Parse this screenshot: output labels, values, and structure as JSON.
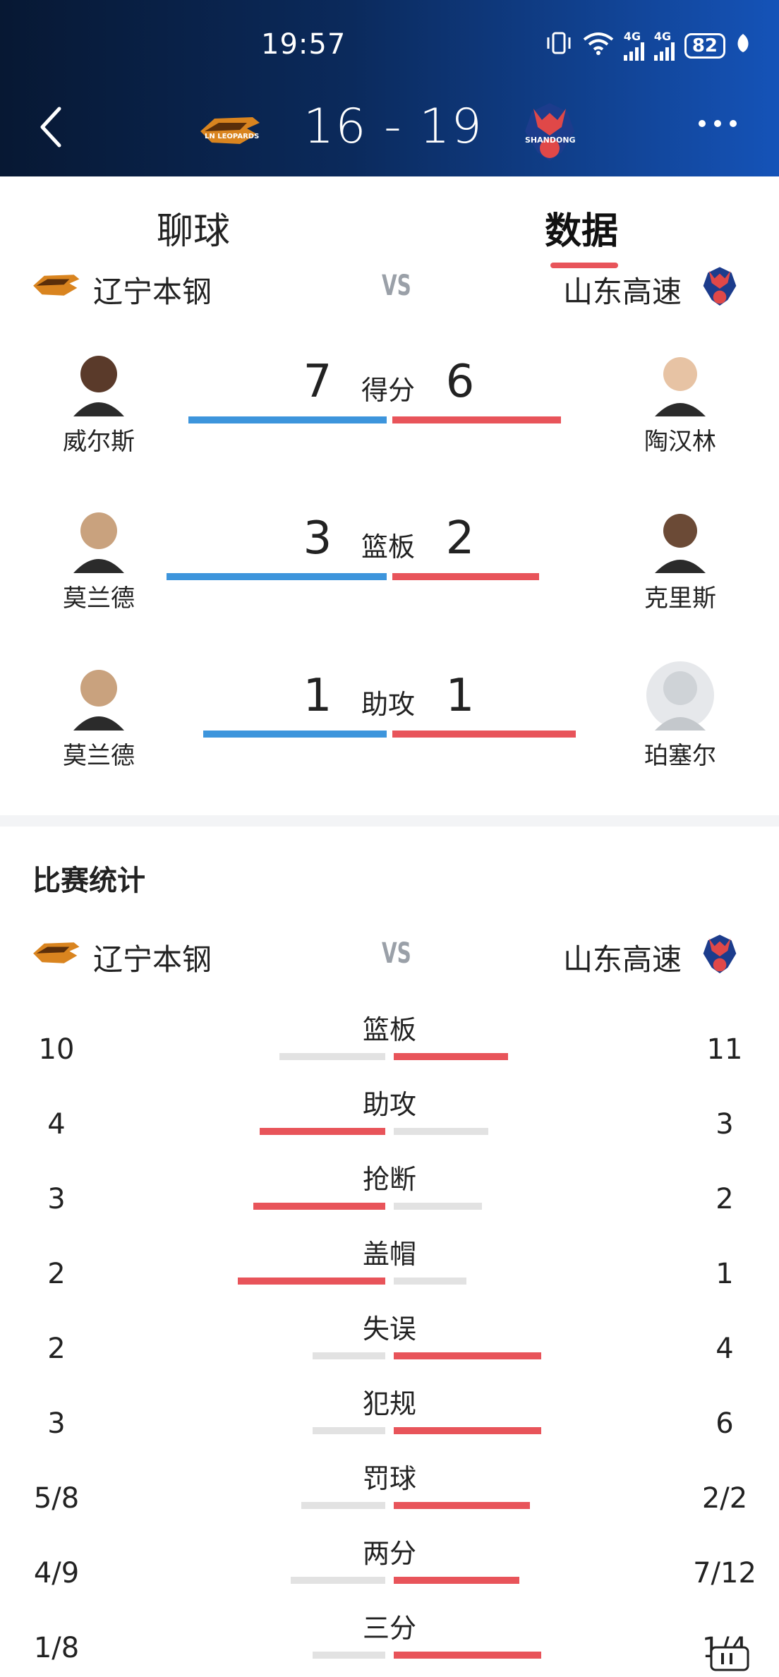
{
  "status_bar": {
    "time": "19:57",
    "battery": "82",
    "net1": "4G",
    "net2": "4G"
  },
  "header": {
    "score": "16 - 19",
    "home_logo_text": "LN LEOPARDS",
    "away_logo_text": "SHANDONG"
  },
  "tabs": [
    {
      "label": "聊球"
    },
    {
      "label": "数据"
    }
  ],
  "teams": {
    "home": "辽宁本钢",
    "away": "山东高速",
    "vs": "VS"
  },
  "leaders": [
    {
      "category": "得分",
      "home_player": "威尔斯",
      "home_value": "7",
      "away_player": "陶汉林",
      "away_value": "6",
      "home_share": 0.54
    },
    {
      "category": "篮板",
      "home_player": "莫兰德",
      "home_value": "3",
      "away_player": "克里斯",
      "away_value": "2",
      "home_share": 0.6
    },
    {
      "category": "助攻",
      "home_player": "莫兰德",
      "home_value": "1",
      "away_player": "珀塞尔",
      "away_value": "1",
      "home_share": 0.5
    }
  ],
  "stats_section": {
    "title": "比赛统计"
  },
  "stats": [
    {
      "category": "篮板",
      "home": "10",
      "away": "11",
      "home_frac": 0.48,
      "away_frac": 0.52,
      "leader": "away"
    },
    {
      "category": "助攻",
      "home": "4",
      "away": "3",
      "home_frac": 0.57,
      "away_frac": 0.43,
      "leader": "home"
    },
    {
      "category": "抢断",
      "home": "3",
      "away": "2",
      "home_frac": 0.6,
      "away_frac": 0.4,
      "leader": "home"
    },
    {
      "category": "盖帽",
      "home": "2",
      "away": "1",
      "home_frac": 0.67,
      "away_frac": 0.33,
      "leader": "home"
    },
    {
      "category": "失误",
      "home": "2",
      "away": "4",
      "home_frac": 0.33,
      "away_frac": 0.67,
      "leader": "away"
    },
    {
      "category": "犯规",
      "home": "3",
      "away": "6",
      "home_frac": 0.33,
      "away_frac": 0.67,
      "leader": "away"
    },
    {
      "category": "罚球",
      "home": "5/8",
      "away": "2/2",
      "home_frac": 0.38,
      "away_frac": 0.62,
      "leader": "away"
    },
    {
      "category": "两分",
      "home": "4/9",
      "away": "7/12",
      "home_frac": 0.43,
      "away_frac": 0.57,
      "leader": "away"
    },
    {
      "category": "三分",
      "home": "1/8",
      "away": "1/4",
      "home_frac": 0.33,
      "away_frac": 0.67,
      "leader": "away"
    }
  ],
  "colors": {
    "home_bar": "#3d95dc",
    "away_bar": "#e8545a",
    "neutral_bar": "#e2e2e2"
  }
}
